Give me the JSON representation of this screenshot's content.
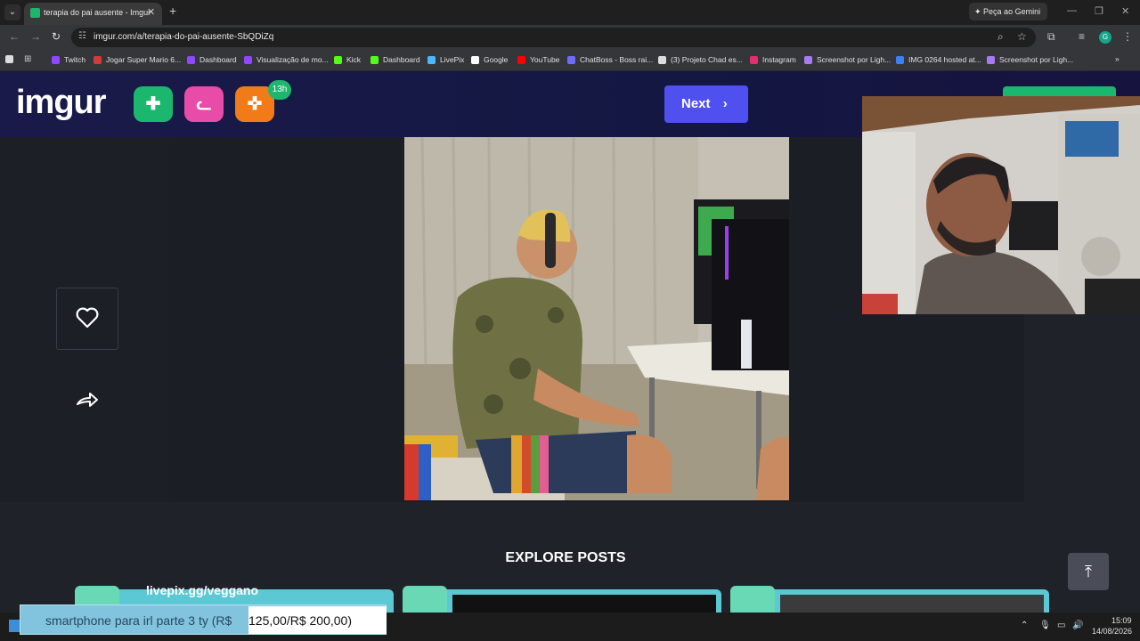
{
  "browser": {
    "tab_title": "terapia do pai ausente - Imgur",
    "url": "imgur.com/a/terapia-do-pai-ausente-SbQDiZq",
    "gemini_label": "Peça ao Gemini",
    "profile_initial": "G",
    "bookmarks": [
      {
        "label": "Twitch",
        "color": "#9146ff"
      },
      {
        "label": "Jogar Super Mario 6...",
        "color": "#d23b3b"
      },
      {
        "label": "Dashboard",
        "color": "#9146ff"
      },
      {
        "label": "Visualização de mo...",
        "color": "#9146ff"
      },
      {
        "label": "Kick",
        "color": "#53fc18"
      },
      {
        "label": "Dashboard",
        "color": "#53fc18"
      },
      {
        "label": "LivePix",
        "color": "#4db6ff"
      },
      {
        "label": "Google",
        "color": "#ffffff"
      },
      {
        "label": "YouTube",
        "color": "#ff0000"
      },
      {
        "label": "ChatBoss - Boss rai...",
        "color": "#6c6cff"
      },
      {
        "label": "(3) Projeto Chad es...",
        "color": "#dddddd"
      },
      {
        "label": "Instagram",
        "color": "#e1306c"
      },
      {
        "label": "Screenshot por Ligh...",
        "color": "#a67cf0"
      },
      {
        "label": "IMG 0264 hosted at...",
        "color": "#3b82f6"
      },
      {
        "label": "Screenshot por Ligh...",
        "color": "#a67cf0"
      }
    ]
  },
  "site": {
    "logo": "imgur",
    "badge_count": "13h",
    "next_label": "Next",
    "explore_title": "EXPLORE POSTS",
    "card_title": "livepix.gg/veggano"
  },
  "overlay": {
    "text": "smartphone para irl parte 3 ty (R$",
    "amount": "125,00/R$ 200,00)",
    "progress": 0.625
  },
  "taskbar": {
    "time": "15:09",
    "date": "14/08/2026"
  },
  "colors": {
    "accent": "#5050f0",
    "imgur_green": "#1bb76e",
    "pink": "#e94ba8",
    "orange": "#f07b18"
  }
}
